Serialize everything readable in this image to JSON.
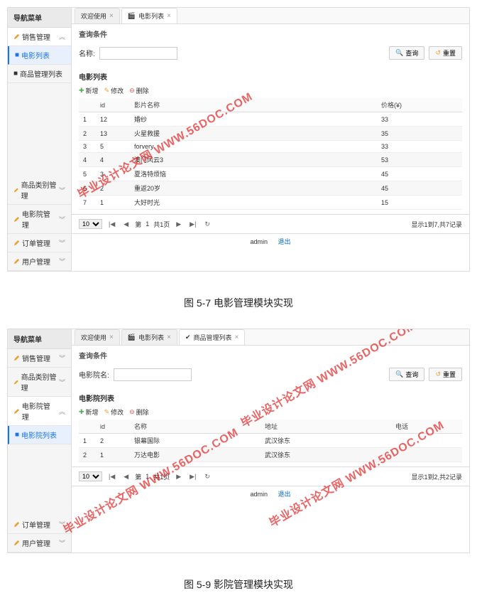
{
  "fig1": {
    "sidebar": {
      "title": "导航菜单",
      "group_sales": "销售管理",
      "item_movie_list": "电影列表",
      "item_goods_list": "商品管理列表",
      "group_goods_type": "商品类别管理",
      "group_cinema": "电影院管理",
      "group_order": "订单管理",
      "group_user": "用户管理"
    },
    "tabs": {
      "welcome": "欢迎使用",
      "movie_list": "电影列表"
    },
    "search": {
      "panel_title": "查询条件",
      "name_label": "名称:",
      "placeholder": "",
      "query_btn": "查询",
      "reset_btn": "重置"
    },
    "list": {
      "title": "电影列表",
      "add": "新增",
      "edit": "修改",
      "del": "删除",
      "cols": {
        "idx": "",
        "id": "id",
        "name": "影片名称",
        "price": "价格(¥)"
      }
    },
    "chart_data": {
      "type": "table",
      "columns": [
        "#",
        "id",
        "影片名称",
        "价格(¥)"
      ],
      "rows": [
        [
          "1",
          "12",
          "婚纱",
          "33"
        ],
        [
          "2",
          "13",
          "火星救援",
          "35"
        ],
        [
          "3",
          "5",
          "forvery",
          "33"
        ],
        [
          "4",
          "4",
          "澳门风云3",
          "53"
        ],
        [
          "5",
          "3",
          "夏洛特烦恼",
          "45"
        ],
        [
          "6",
          "2",
          "重返20岁",
          "45"
        ],
        [
          "7",
          "1",
          "大好时光",
          "15"
        ]
      ]
    },
    "pager": {
      "page_size": "10",
      "page_label_a": "第",
      "page_num": "1",
      "page_label_b": "共1页",
      "summary": "显示1到7,共7记录"
    },
    "footer": {
      "user": "admin",
      "logout": "退出"
    },
    "caption": "图 5-7  电影管理模块实现"
  },
  "fig2": {
    "sidebar": {
      "title": "导航菜单",
      "group_sales": "销售管理",
      "group_goods_type": "商品类别管理",
      "group_cinema": "电影院管理",
      "item_cinema_list": "电影院列表",
      "group_order": "订单管理",
      "group_user": "用户管理"
    },
    "tabs": {
      "welcome": "欢迎使用",
      "movie_list": "电影列表",
      "goods_list": "商品管理列表"
    },
    "search": {
      "panel_title": "查询条件",
      "name_label": "电影院名:",
      "placeholder": "",
      "query_btn": "查询",
      "reset_btn": "重置"
    },
    "list": {
      "title": "电影院列表",
      "add": "新增",
      "edit": "修改",
      "del": "删除",
      "cols": {
        "idx": "",
        "id": "id",
        "name": "名称",
        "addr": "地址",
        "tel": "电话"
      }
    },
    "chart_data": {
      "type": "table",
      "columns": [
        "#",
        "id",
        "名称",
        "地址",
        "电话"
      ],
      "rows": [
        [
          "1",
          "2",
          "银幕国际",
          "武汉徐东",
          ""
        ],
        [
          "2",
          "1",
          "万达电影",
          "武汉徐东",
          ""
        ]
      ]
    },
    "pager": {
      "page_size": "10",
      "page_label_a": "第",
      "page_num": "1",
      "page_label_b": "共1页",
      "summary": "显示1到2,共2记录"
    },
    "footer": {
      "user": "admin",
      "logout": "退出"
    },
    "caption": "图 5-9  影院管理模块实现"
  },
  "watermark": "毕业设计论文网  WWW.56DOC.COM"
}
